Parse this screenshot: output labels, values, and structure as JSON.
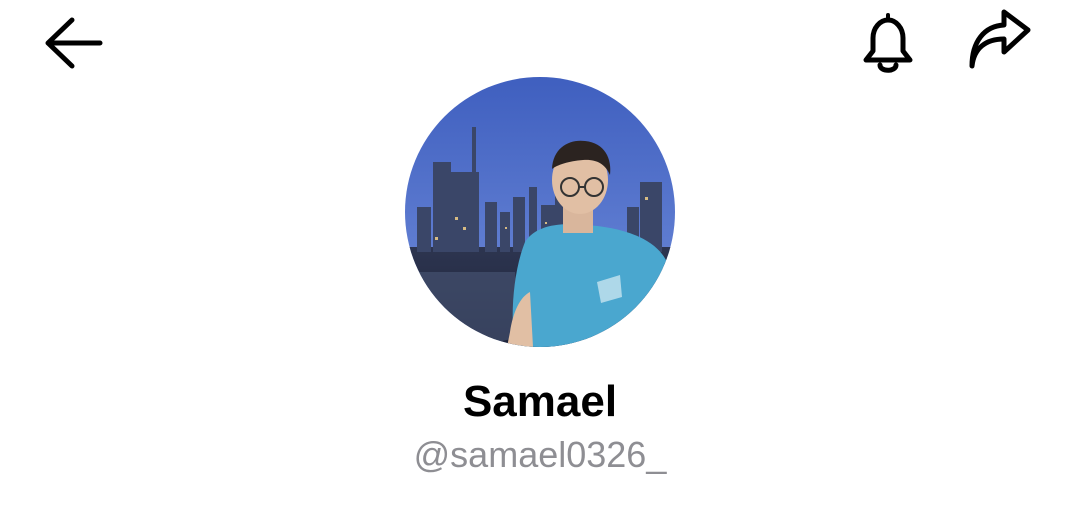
{
  "header": {
    "back_icon": "arrow-left-icon",
    "notifications_icon": "bell-icon",
    "share_icon": "share-arrow-icon"
  },
  "profile": {
    "display_name": "Samael",
    "handle": "@samael0326_",
    "avatar": "profile-photo"
  },
  "colors": {
    "text_primary": "#000000",
    "text_secondary": "#8e8e93",
    "background": "#ffffff"
  }
}
